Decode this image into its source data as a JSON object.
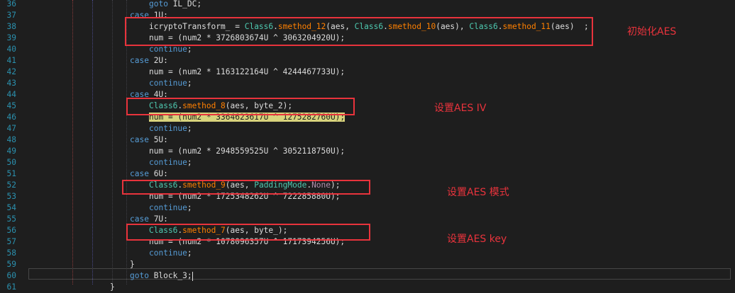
{
  "editor": {
    "lines": [
      {
        "no": "36",
        "tokens": [
          {
            "t": "goto ",
            "c": "kw"
          },
          {
            "t": "IL_DC;",
            "c": ""
          }
        ]
      },
      {
        "no": "37",
        "tokens": [
          {
            "t": "case ",
            "c": "kw"
          },
          {
            "t": "1U:",
            "c": ""
          }
        ]
      },
      {
        "no": "38",
        "tokens": [
          {
            "t": "icryptoTransform_ = ",
            "c": ""
          },
          {
            "t": "Class6",
            "c": "cls"
          },
          {
            "t": ".",
            "c": ""
          },
          {
            "t": "smethod_12",
            "c": "mth"
          },
          {
            "t": "(aes, ",
            "c": ""
          },
          {
            "t": "Class6",
            "c": "cls"
          },
          {
            "t": ".",
            "c": ""
          },
          {
            "t": "smethod_10",
            "c": "mth"
          },
          {
            "t": "(aes), ",
            "c": ""
          },
          {
            "t": "Class6",
            "c": "cls"
          },
          {
            "t": ".",
            "c": ""
          },
          {
            "t": "smethod_11",
            "c": "mth"
          },
          {
            "t": "(aes)",
            "c": ""
          }
        ]
      },
      {
        "no": "39",
        "tokens": [
          {
            "t": "num = (num2 * 3726803674U ^ 3063204920U);",
            "c": ""
          }
        ]
      },
      {
        "no": "40",
        "tokens": [
          {
            "t": "continue",
            "c": "kw"
          },
          {
            "t": ";",
            "c": ""
          }
        ]
      },
      {
        "no": "41",
        "tokens": [
          {
            "t": "case ",
            "c": "kw"
          },
          {
            "t": "2U:",
            "c": ""
          }
        ]
      },
      {
        "no": "42",
        "tokens": [
          {
            "t": "num = (num2 * 1163122164U ^ 4244467733U);",
            "c": ""
          }
        ]
      },
      {
        "no": "43",
        "tokens": [
          {
            "t": "continue",
            "c": "kw"
          },
          {
            "t": ";",
            "c": ""
          }
        ]
      },
      {
        "no": "44",
        "tokens": [
          {
            "t": "case ",
            "c": "kw"
          },
          {
            "t": "4U:",
            "c": ""
          }
        ]
      },
      {
        "no": "45",
        "tokens": [
          {
            "t": "Class6",
            "c": "cls"
          },
          {
            "t": ".",
            "c": ""
          },
          {
            "t": "smethod_8",
            "c": "mth"
          },
          {
            "t": "(aes, byte_2);",
            "c": ""
          }
        ]
      },
      {
        "no": "46",
        "tokens": [
          {
            "t": "num = (num2 * 3364623617U ^ 1275282760U);",
            "c": "hl"
          }
        ]
      },
      {
        "no": "47",
        "tokens": [
          {
            "t": "continue",
            "c": "kw"
          },
          {
            "t": ";",
            "c": ""
          }
        ]
      },
      {
        "no": "48",
        "tokens": [
          {
            "t": "case ",
            "c": "kw"
          },
          {
            "t": "5U:",
            "c": ""
          }
        ]
      },
      {
        "no": "49",
        "tokens": [
          {
            "t": "num = (num2 * 2948559525U ^ 3052118750U);",
            "c": ""
          }
        ]
      },
      {
        "no": "50",
        "tokens": [
          {
            "t": "continue",
            "c": "kw"
          },
          {
            "t": ";",
            "c": ""
          }
        ]
      },
      {
        "no": "51",
        "tokens": [
          {
            "t": "case ",
            "c": "kw"
          },
          {
            "t": "6U:",
            "c": ""
          }
        ]
      },
      {
        "no": "52",
        "tokens": [
          {
            "t": "Class6",
            "c": "cls"
          },
          {
            "t": ".",
            "c": ""
          },
          {
            "t": "smethod_9",
            "c": "mth"
          },
          {
            "t": "(aes, ",
            "c": ""
          },
          {
            "t": "PaddingMode",
            "c": "cls"
          },
          {
            "t": ".",
            "c": ""
          },
          {
            "t": "None",
            "c": "enmv"
          },
          {
            "t": ");",
            "c": ""
          }
        ]
      },
      {
        "no": "53",
        "tokens": [
          {
            "t": "num = (num2 * 1725348262U ^ 722285880U);",
            "c": ""
          }
        ]
      },
      {
        "no": "54",
        "tokens": [
          {
            "t": "continue",
            "c": "kw"
          },
          {
            "t": ";",
            "c": ""
          }
        ]
      },
      {
        "no": "55",
        "tokens": [
          {
            "t": "case ",
            "c": "kw"
          },
          {
            "t": "7U:",
            "c": ""
          }
        ]
      },
      {
        "no": "56",
        "tokens": [
          {
            "t": "Class6",
            "c": "cls"
          },
          {
            "t": ".",
            "c": ""
          },
          {
            "t": "smethod_7",
            "c": "mth"
          },
          {
            "t": "(aes, byte_);",
            "c": ""
          }
        ]
      },
      {
        "no": "57",
        "tokens": [
          {
            "t": "num = (num2 * 1078096357U ^ 1717394256U);",
            "c": ""
          }
        ]
      },
      {
        "no": "58",
        "tokens": [
          {
            "t": "continue",
            "c": "kw"
          },
          {
            "t": ";",
            "c": ""
          }
        ]
      },
      {
        "no": "59",
        "tokens": [
          {
            "t": "}",
            "c": ""
          }
        ]
      },
      {
        "no": "60",
        "tokens": [
          {
            "t": "goto ",
            "c": "kw"
          },
          {
            "t": "Block_3;",
            "c": ""
          }
        ]
      },
      {
        "no": "61",
        "tokens": [
          {
            "t": "}",
            "c": ""
          }
        ]
      }
    ],
    "line38_suffix": ";"
  },
  "annotations": {
    "init_aes": "初始化AES",
    "set_iv": "设置AES IV",
    "set_mode": "设置AES 模式",
    "set_key": "设置AES key"
  },
  "colors": {
    "background": "#1e1e1e",
    "annotation": "#e8333c",
    "keyword": "#569cd6",
    "class": "#4ec9b0",
    "method": "#ff8000"
  }
}
